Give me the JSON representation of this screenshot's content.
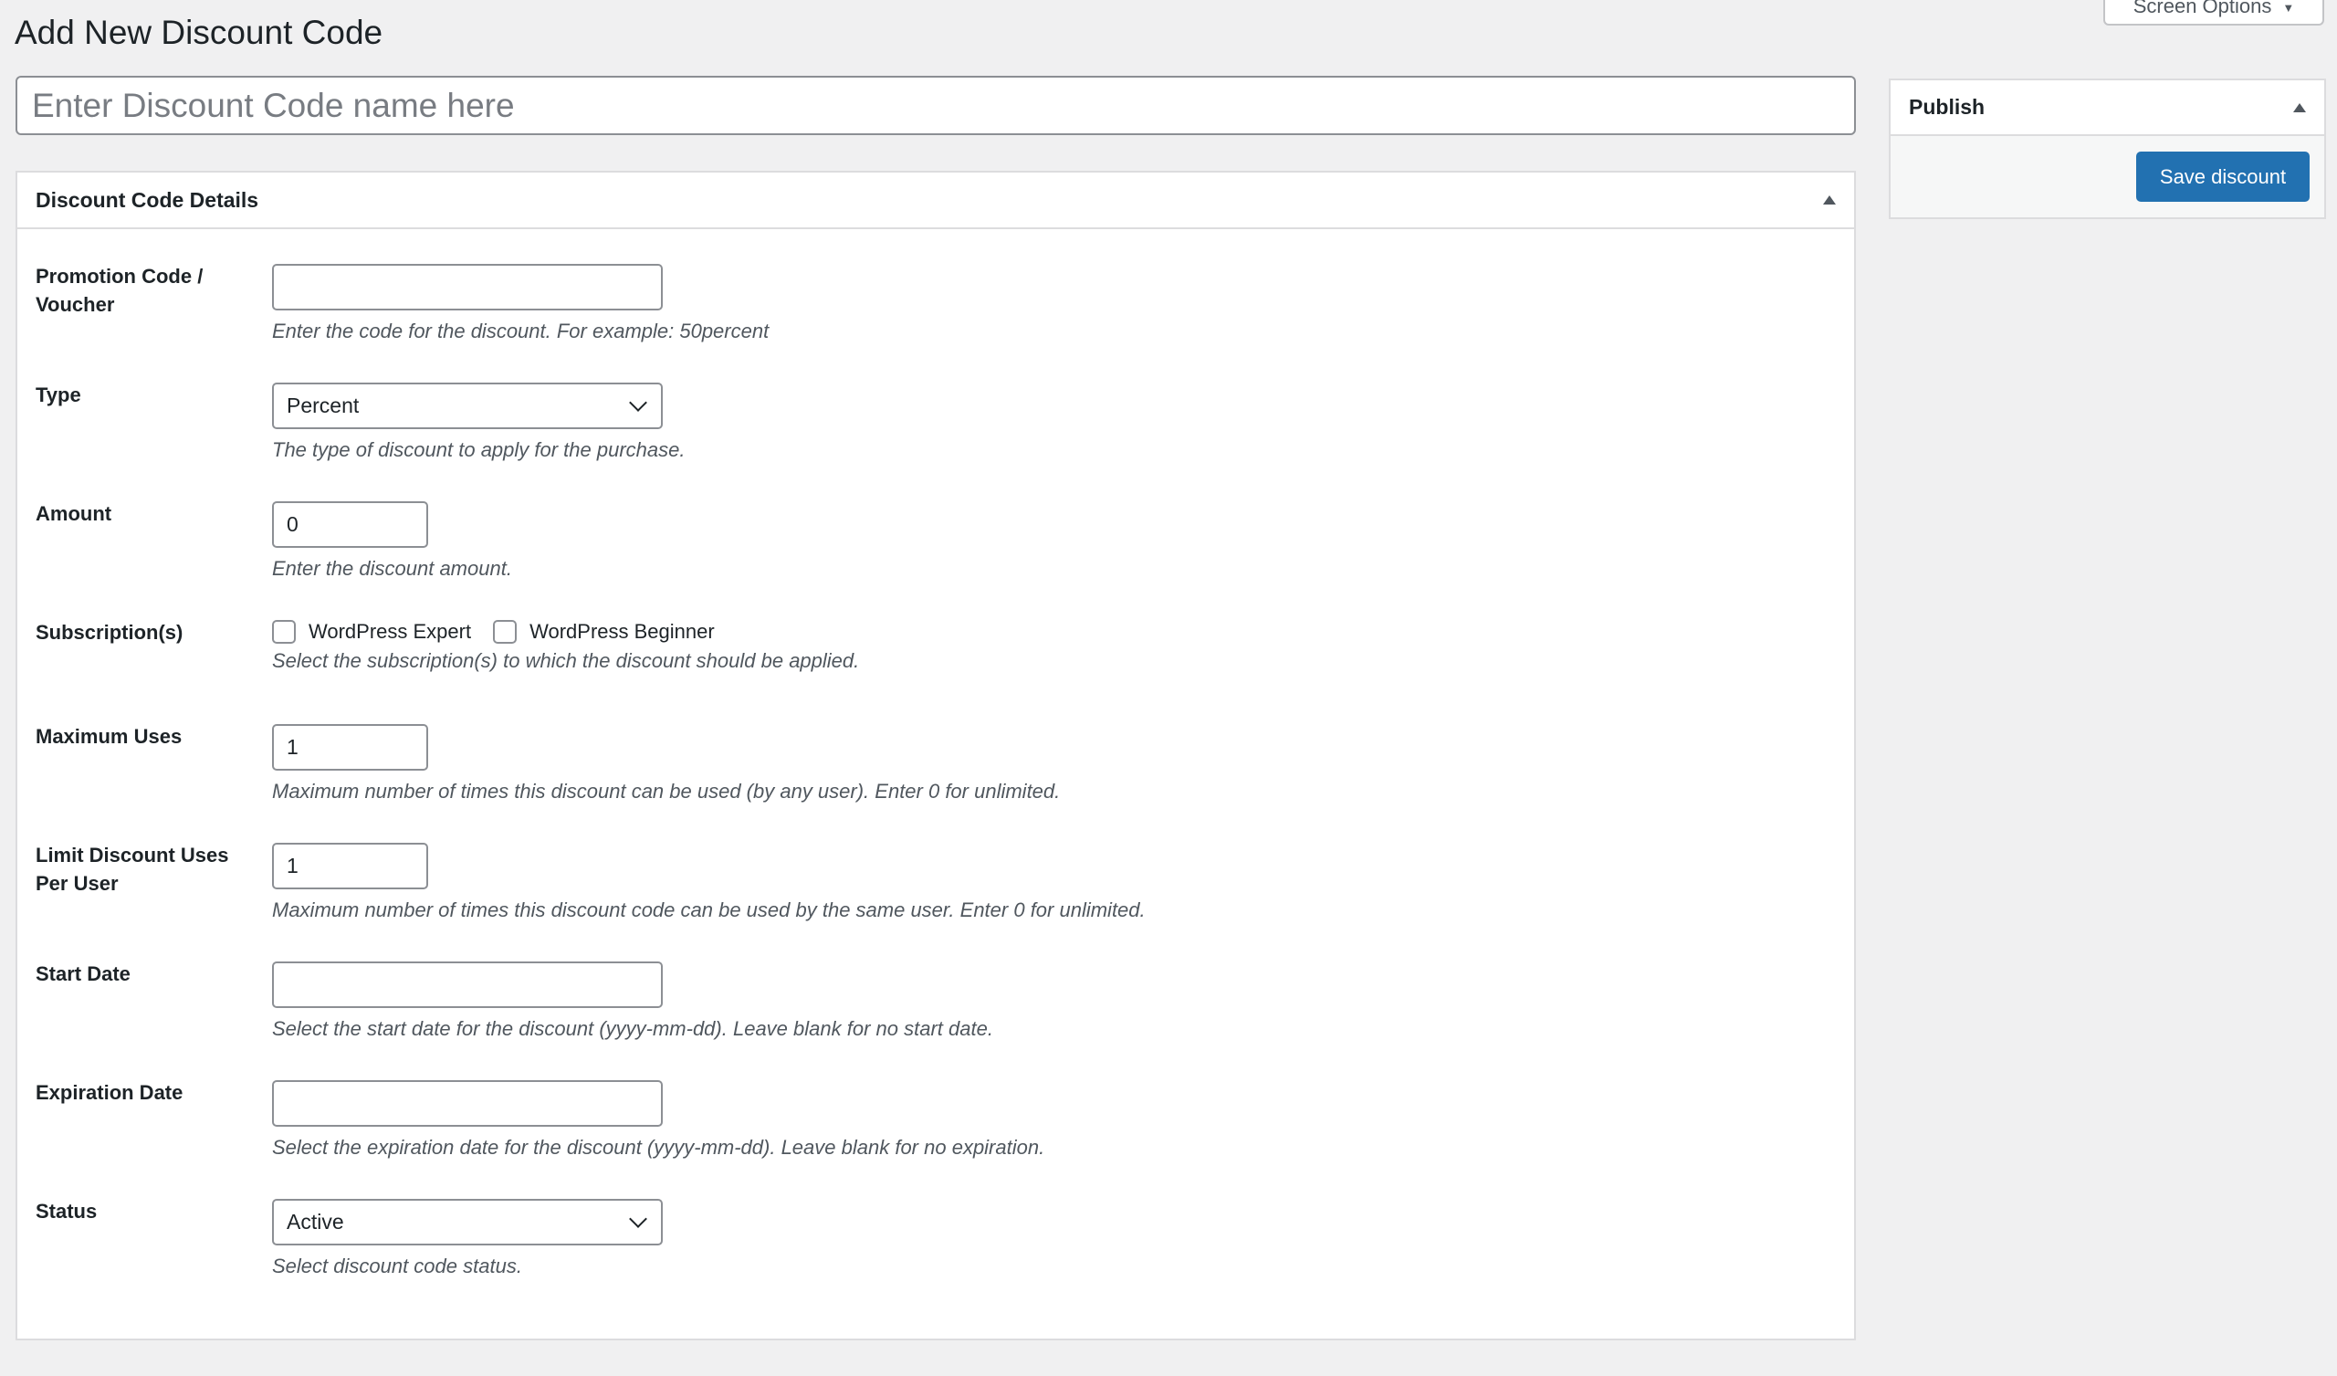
{
  "page": {
    "title": "Add New Discount Code",
    "screen_options_label": "Screen Options",
    "title_placeholder": "Enter Discount Code name here"
  },
  "publish": {
    "title": "Publish",
    "save_label": "Save discount"
  },
  "details": {
    "title": "Discount Code Details",
    "code": {
      "label": "Promotion Code / Voucher",
      "value": "",
      "description": "Enter the code for the discount. For example: 50percent"
    },
    "type": {
      "label": "Type",
      "selected": "Percent",
      "description": "The type of discount to apply for the purchase."
    },
    "amount": {
      "label": "Amount",
      "value": "0",
      "description": "Enter the discount amount."
    },
    "subscriptions": {
      "label": "Subscription(s)",
      "options": [
        {
          "label": "WordPress Expert",
          "checked": false
        },
        {
          "label": "WordPress Beginner",
          "checked": false
        }
      ],
      "description": "Select the subscription(s) to which the discount should be applied."
    },
    "max_uses": {
      "label": "Maximum Uses",
      "value": "1",
      "description": "Maximum number of times this discount can be used (by any user). Enter 0 for unlimited."
    },
    "limit_per_user": {
      "label": "Limit Discount Uses Per User",
      "value": "1",
      "description": "Maximum number of times this discount code can be used by the same user. Enter 0 for unlimited."
    },
    "start_date": {
      "label": "Start Date",
      "value": "",
      "description": "Select the start date for the discount (yyyy-mm-dd). Leave blank for no start date."
    },
    "expiration_date": {
      "label": "Expiration Date",
      "value": "",
      "description": "Select the expiration date for the discount (yyyy-mm-dd). Leave blank for no expiration."
    },
    "status": {
      "label": "Status",
      "selected": "Active",
      "description": "Select discount code status."
    }
  },
  "colors": {
    "primary_button": "#2271b1",
    "background": "#f0f0f1"
  }
}
